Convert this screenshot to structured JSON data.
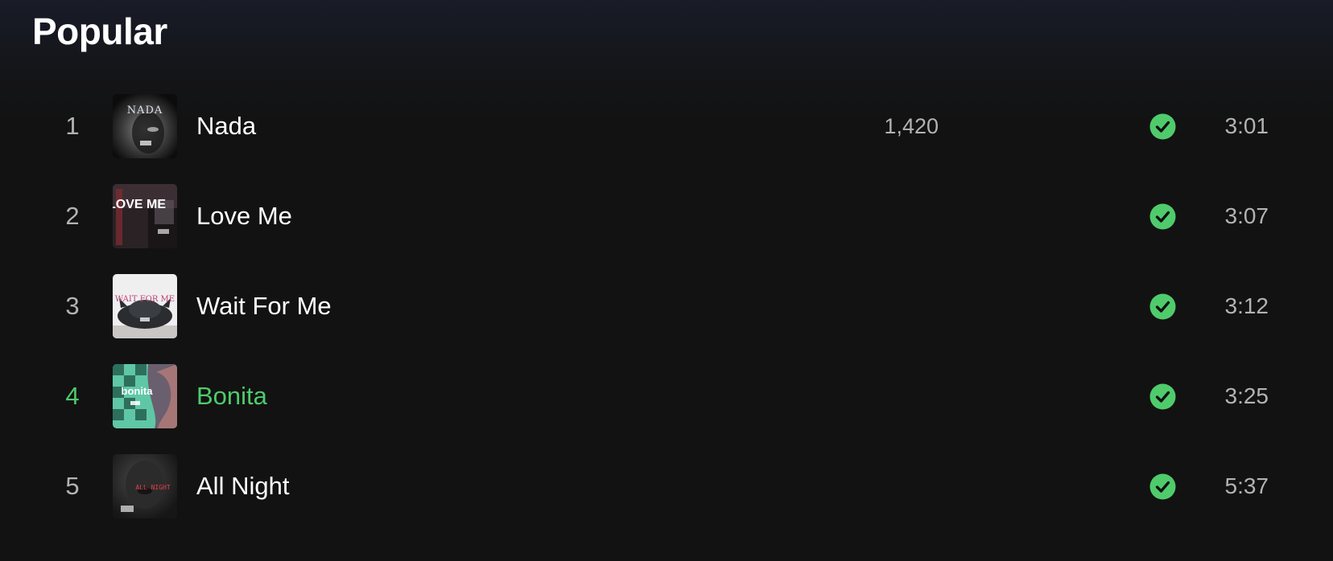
{
  "section": {
    "title": "Popular"
  },
  "colors": {
    "accent": "#4fcb6c",
    "text_secondary": "#b3b3b3",
    "background": "#121212"
  },
  "tracks": [
    {
      "number": "1",
      "title": "Nada",
      "plays": "1,420",
      "duration": "3:01",
      "saved": true,
      "active": false,
      "cover_text": "NADA"
    },
    {
      "number": "2",
      "title": "Love Me",
      "plays": "",
      "duration": "3:07",
      "saved": true,
      "active": false,
      "cover_text": "LOVE ME"
    },
    {
      "number": "3",
      "title": "Wait For Me",
      "plays": "",
      "duration": "3:12",
      "saved": true,
      "active": false,
      "cover_text": "WAIT FOR ME"
    },
    {
      "number": "4",
      "title": "Bonita",
      "plays": "",
      "duration": "3:25",
      "saved": true,
      "active": true,
      "cover_text": "bonita"
    },
    {
      "number": "5",
      "title": "All Night",
      "plays": "",
      "duration": "5:37",
      "saved": true,
      "active": false,
      "cover_text": "ALL NIGHT"
    }
  ],
  "icons": {
    "saved": "check-circle-icon"
  }
}
